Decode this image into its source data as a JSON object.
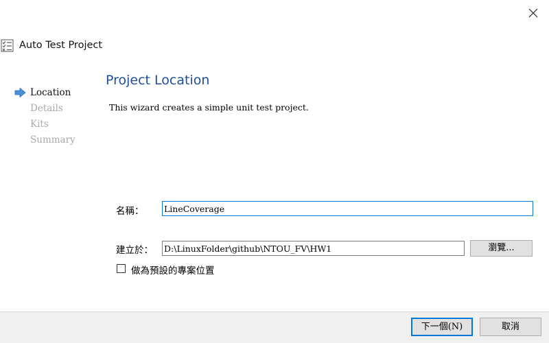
{
  "window": {
    "title": "Auto Test Project",
    "close_icon": "close-icon",
    "app_icon": "checklist-icon"
  },
  "steps": [
    {
      "label": "Location",
      "active": true
    },
    {
      "label": "Details",
      "active": false
    },
    {
      "label": "Kits",
      "active": false
    },
    {
      "label": "Summary",
      "active": false
    }
  ],
  "page": {
    "title": "Project Location",
    "description": "This wizard creates a simple unit test project."
  },
  "form": {
    "name_label": "名稱：",
    "name_value": "LineCoverage",
    "create_in_label": "建立於：",
    "create_in_value": "D:\\LinuxFolder\\github\\NTOU_FV\\HW1",
    "browse_label": "瀏覽...",
    "default_location_label": "做為預設的專案位置",
    "default_location_checked": false
  },
  "footer": {
    "next_label": "下一個(N)",
    "cancel_label": "取消"
  },
  "colors": {
    "title_blue": "#1e4f9c",
    "arrow_blue": "#4a90d9",
    "focus_border": "#0078d7"
  }
}
